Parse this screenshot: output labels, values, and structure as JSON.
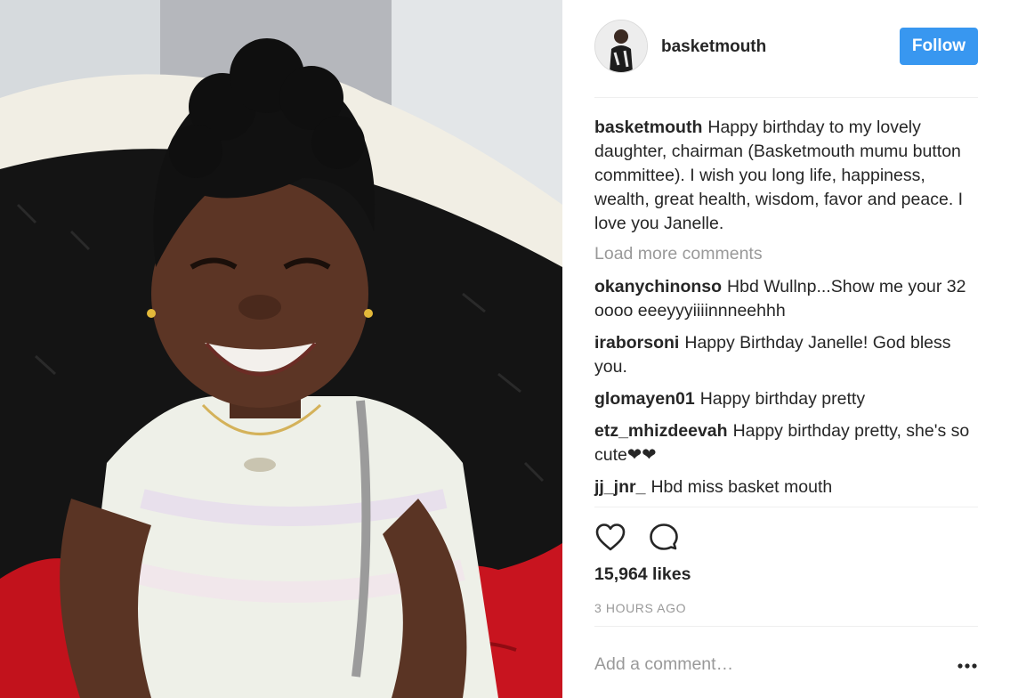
{
  "post": {
    "username": "basketmouth",
    "follow_label": "Follow",
    "caption": {
      "username": "basketmouth",
      "text": "Happy birthday to my lovely daughter, chairman (Basketmouth mumu button committee). I wish you long life, happiness, wealth, great health, wisdom, favor and peace. I love you Janelle."
    },
    "load_more_label": "Load more comments",
    "comments": [
      {
        "username": "okanychinonso",
        "text": "Hbd Wullnp...Show me your 32 oooo eeeyyyiiiinnneehhh"
      },
      {
        "username": "iraborsoni",
        "text": "Happy Birthday Janelle! God bless you."
      },
      {
        "username": "glomayen01",
        "text": "Happy birthday pretty"
      },
      {
        "username": "etz_mhizdeevah",
        "text": "Happy birthday pretty, she's so cute❤❤"
      },
      {
        "username": "jj_jnr_",
        "text": "Hbd miss basket mouth"
      }
    ],
    "likes_text": "15,964 likes",
    "time_text": "3 HOURS AGO",
    "add_comment_placeholder": "Add a comment…"
  },
  "icons": {
    "like": "heart-outline-icon",
    "comment": "speech-bubble-icon",
    "more": "ellipsis-icon"
  },
  "colors": {
    "follow_button": "#3897f0",
    "secondary_text": "#999999",
    "primary_text": "#262626"
  }
}
